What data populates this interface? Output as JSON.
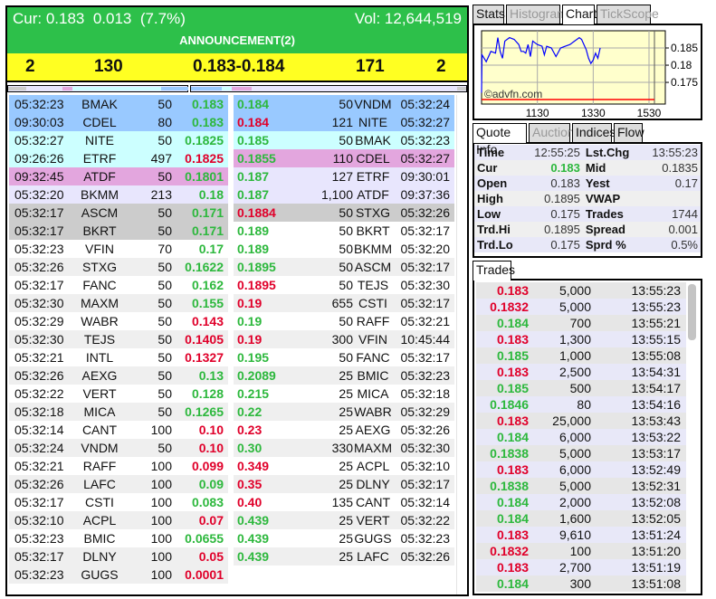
{
  "header": {
    "cur_text": "Cur: 0.183  0.013  (7.7%)",
    "vol_text": "Vol: 12,644,519",
    "announcement": "ANNOUNCEMENT(2)",
    "colors": {
      "green": "#2dc04a",
      "yellow": "#ffff22"
    }
  },
  "summary": {
    "bid_count": "2",
    "bid_volume": "130",
    "bid_ask": "0.183-0.184",
    "ask_volume": "171",
    "ask_count": "2"
  },
  "bids": [
    [
      "05:32:23",
      "BMAK",
      "50",
      "0.183",
      "g",
      "blue"
    ],
    [
      "09:30:03",
      "CDEL",
      "80",
      "0.183",
      "g",
      "blue"
    ],
    [
      "05:32:27",
      "NITE",
      "50",
      "0.1825",
      "g",
      "cyan"
    ],
    [
      "09:26:26",
      "ETRF",
      "497",
      "0.1825",
      "r",
      "cyan"
    ],
    [
      "09:32:45",
      "ATDF",
      "50",
      "0.1801",
      "g",
      "pink"
    ],
    [
      "05:32:20",
      "BKMM",
      "213",
      "0.18",
      "g",
      "lav"
    ],
    [
      "05:32:17",
      "ASCM",
      "50",
      "0.171",
      "g",
      "gray"
    ],
    [
      "05:32:17",
      "BKRT",
      "50",
      "0.171",
      "g",
      "gray"
    ],
    [
      "05:32:23",
      "VFIN",
      "70",
      "0.17",
      "g",
      "white"
    ],
    [
      "05:32:26",
      "STXG",
      "50",
      "0.1622",
      "g",
      "light"
    ],
    [
      "05:32:17",
      "FANC",
      "50",
      "0.162",
      "g",
      "white"
    ],
    [
      "05:32:30",
      "MAXM",
      "50",
      "0.155",
      "g",
      "light"
    ],
    [
      "05:32:29",
      "WABR",
      "50",
      "0.143",
      "r",
      "white"
    ],
    [
      "05:32:30",
      "TEJS",
      "50",
      "0.1405",
      "r",
      "light"
    ],
    [
      "05:32:21",
      "INTL",
      "50",
      "0.1327",
      "r",
      "white"
    ],
    [
      "05:32:26",
      "AEXG",
      "50",
      "0.13",
      "g",
      "light"
    ],
    [
      "05:32:22",
      "VERT",
      "50",
      "0.128",
      "g",
      "white"
    ],
    [
      "05:32:18",
      "MICA",
      "50",
      "0.1265",
      "g",
      "light"
    ],
    [
      "05:32:14",
      "CANT",
      "100",
      "0.10",
      "r",
      "white"
    ],
    [
      "05:32:24",
      "VNDM",
      "50",
      "0.10",
      "r",
      "light"
    ],
    [
      "05:32:21",
      "RAFF",
      "100",
      "0.099",
      "r",
      "white"
    ],
    [
      "05:32:26",
      "LAFC",
      "100",
      "0.09",
      "g",
      "light"
    ],
    [
      "05:32:17",
      "CSTI",
      "100",
      "0.083",
      "g",
      "white"
    ],
    [
      "05:32:10",
      "ACPL",
      "100",
      "0.07",
      "r",
      "light"
    ],
    [
      "05:32:23",
      "BMIC",
      "100",
      "0.0655",
      "g",
      "white"
    ],
    [
      "05:32:17",
      "DLNY",
      "100",
      "0.05",
      "r",
      "light"
    ],
    [
      "05:32:23",
      "GUGS",
      "100",
      "0.0001",
      "r",
      "light"
    ]
  ],
  "asks": [
    [
      "0.184",
      "g",
      "50",
      "VNDM",
      "05:32:24",
      "blue"
    ],
    [
      "0.184",
      "r",
      "121",
      "NITE",
      "05:32:27",
      "blue"
    ],
    [
      "0.185",
      "g",
      "50",
      "BMAK",
      "05:32:23",
      "cyan"
    ],
    [
      "0.1855",
      "g",
      "110",
      "CDEL",
      "05:32:27",
      "pink"
    ],
    [
      "0.187",
      "g",
      "127",
      "ETRF",
      "09:30:01",
      "lav"
    ],
    [
      "0.187",
      "g",
      "1,100",
      "ATDF",
      "09:37:36",
      "lav"
    ],
    [
      "0.1884",
      "r",
      "50",
      "STXG",
      "05:32:26",
      "gray"
    ],
    [
      "0.189",
      "g",
      "50",
      "BKRT",
      "05:32:17",
      "white"
    ],
    [
      "0.189",
      "g",
      "50",
      "BKMM",
      "05:32:20",
      "white"
    ],
    [
      "0.1895",
      "g",
      "50",
      "ASCM",
      "05:32:17",
      "light"
    ],
    [
      "0.1895",
      "r",
      "50",
      "TEJS",
      "05:32:30",
      "white"
    ],
    [
      "0.19",
      "r",
      "655",
      "CSTI",
      "05:32:17",
      "light"
    ],
    [
      "0.19",
      "g",
      "50",
      "RAFF",
      "05:32:21",
      "white"
    ],
    [
      "0.19",
      "r",
      "300",
      "VFIN",
      "10:45:44",
      "light"
    ],
    [
      "0.195",
      "g",
      "50",
      "FANC",
      "05:32:17",
      "white"
    ],
    [
      "0.2089",
      "g",
      "25",
      "BMIC",
      "05:32:23",
      "light"
    ],
    [
      "0.215",
      "g",
      "25",
      "MICA",
      "05:32:18",
      "white"
    ],
    [
      "0.22",
      "g",
      "25",
      "WABR",
      "05:32:29",
      "light"
    ],
    [
      "0.23",
      "r",
      "25",
      "AEXG",
      "05:32:26",
      "white"
    ],
    [
      "0.30",
      "g",
      "330",
      "MAXM",
      "05:32:30",
      "light"
    ],
    [
      "0.349",
      "r",
      "25",
      "ACPL",
      "05:32:10",
      "white"
    ],
    [
      "0.35",
      "r",
      "25",
      "DLNY",
      "05:32:17",
      "light"
    ],
    [
      "0.40",
      "r",
      "135",
      "CANT",
      "05:32:14",
      "white"
    ],
    [
      "0.439",
      "g",
      "25",
      "VERT",
      "05:32:22",
      "light"
    ],
    [
      "0.439",
      "g",
      "25",
      "GUGS",
      "05:32:23",
      "white"
    ],
    [
      "0.439",
      "g",
      "25",
      "LAFC",
      "05:32:26",
      "light"
    ]
  ],
  "chart_tabs": [
    {
      "label": "Stats",
      "state": "normal"
    },
    {
      "label": "Histogram",
      "state": "disabled"
    },
    {
      "label": "Chart",
      "state": "active"
    },
    {
      "label": "TickScope",
      "state": "disabled"
    }
  ],
  "chart_data": {
    "type": "line",
    "watermark": "©advfn.com",
    "x_ticks": [
      "1130",
      "1330",
      "1530"
    ],
    "y_ticks": [
      "0.185",
      "0.18",
      "0.175"
    ],
    "yesterday_close": 0.17,
    "ylim": [
      0.1687,
      0.19
    ],
    "xlim": [
      "09:30",
      "16:05"
    ],
    "line_color": "#0000ff",
    "ref_line_color": "#ff0000",
    "background": "#ffffcc",
    "grid": true,
    "x": [
      "09:30",
      "09:31",
      "09:40",
      "09:50",
      "10:00",
      "10:05",
      "10:10",
      "10:15",
      "10:20",
      "10:30",
      "10:40",
      "10:50",
      "10:55",
      "11:00",
      "11:05",
      "11:10",
      "11:15",
      "11:20",
      "11:30",
      "11:40",
      "11:45",
      "11:50",
      "12:00",
      "12:10",
      "12:20",
      "12:30",
      "12:40",
      "12:50",
      "13:00",
      "13:05",
      "13:15",
      "13:20",
      "13:25",
      "13:30",
      "13:35",
      "13:40",
      "13:45"
    ],
    "values": [
      0.172,
      0.183,
      0.181,
      0.184,
      0.1835,
      0.188,
      0.184,
      0.182,
      0.187,
      0.188,
      0.1875,
      0.186,
      0.184,
      0.184,
      0.1835,
      0.186,
      0.1825,
      0.187,
      0.186,
      0.1855,
      0.183,
      0.1855,
      0.185,
      0.1825,
      0.185,
      0.1855,
      0.186,
      0.187,
      0.188,
      0.1875,
      0.1845,
      0.182,
      0.1805,
      0.1815,
      0.1835,
      0.182,
      0.185
    ]
  },
  "quote_tabs": [
    {
      "label": "Quote Info",
      "state": "active"
    },
    {
      "label": "Auction",
      "state": "disabled"
    },
    {
      "label": "Indices",
      "state": "normal"
    },
    {
      "label": "Flow",
      "state": "normal"
    }
  ],
  "quote": [
    [
      "Time",
      "12:55:25",
      "Lst.Chg",
      "13:55:23"
    ],
    [
      "Cur",
      "0.183",
      "Mid",
      "0.1835"
    ],
    [
      "Open",
      "0.183",
      "Yest",
      "0.17"
    ],
    [
      "High",
      "0.1895",
      "VWAP",
      ""
    ],
    [
      "Low",
      "0.175",
      "Trades",
      "1744"
    ],
    [
      "Trd.Hi",
      "0.1895",
      "Spread",
      "0.001"
    ],
    [
      "Trd.Lo",
      "0.175",
      "Sprd %",
      "0.5%"
    ]
  ],
  "trades_tab": "Trades",
  "trades": [
    [
      "0.183",
      "r",
      "5,000",
      "13:55:23"
    ],
    [
      "0.1832",
      "r",
      "5,000",
      "13:55:23"
    ],
    [
      "0.184",
      "g",
      "700",
      "13:55:21"
    ],
    [
      "0.183",
      "r",
      "1,300",
      "13:55:15"
    ],
    [
      "0.185",
      "g",
      "1,000",
      "13:55:08"
    ],
    [
      "0.183",
      "r",
      "2,500",
      "13:54:31"
    ],
    [
      "0.185",
      "g",
      "500",
      "13:54:17"
    ],
    [
      "0.1846",
      "g",
      "80",
      "13:54:16"
    ],
    [
      "0.183",
      "r",
      "25,000",
      "13:53:43"
    ],
    [
      "0.184",
      "g",
      "6,000",
      "13:53:22"
    ],
    [
      "0.1838",
      "g",
      "5,000",
      "13:53:17"
    ],
    [
      "0.183",
      "r",
      "6,000",
      "13:52:49"
    ],
    [
      "0.1838",
      "g",
      "5,000",
      "13:52:31"
    ],
    [
      "0.184",
      "g",
      "2,000",
      "13:52:08"
    ],
    [
      "0.184",
      "g",
      "1,600",
      "13:52:05"
    ],
    [
      "0.183",
      "r",
      "9,610",
      "13:51:24"
    ],
    [
      "0.1832",
      "r",
      "100",
      "13:51:20"
    ],
    [
      "0.183",
      "r",
      "2,700",
      "13:51:19"
    ],
    [
      "0.184",
      "g",
      "300",
      "13:51:08"
    ]
  ]
}
